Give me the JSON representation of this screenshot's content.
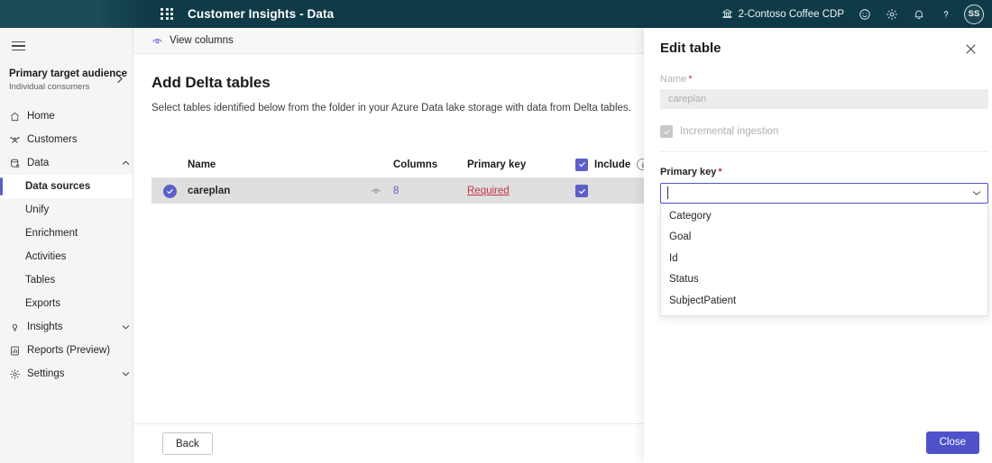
{
  "header": {
    "app_title": "Customer Insights - Data",
    "waffle_icon": "app-launcher-icon",
    "environment": "2-Contoso Coffee CDP",
    "environment_icon": "environment-icon",
    "feedback_icon": "smiley-feedback-icon",
    "settings_icon": "gear-icon",
    "notifications_icon": "bell-icon",
    "help_icon": "question-mark-icon",
    "avatar_initials": "SS"
  },
  "sidebar": {
    "menu_icon": "hamburger-menu-icon",
    "audience": {
      "title": "Primary target audience",
      "subtitle": "Individual consumers",
      "chevron": "chevron-right-icon"
    },
    "items": [
      {
        "label": "Home",
        "icon": "home-icon",
        "level": "top",
        "active": false,
        "expandable": false
      },
      {
        "label": "Customers",
        "icon": "customers-icon",
        "level": "top",
        "active": false,
        "expandable": false
      },
      {
        "label": "Data",
        "icon": "database-icon",
        "level": "top",
        "active": false,
        "expandable": true,
        "expanded": true
      },
      {
        "label": "Data sources",
        "icon": "",
        "level": "sub",
        "active": true,
        "expandable": false
      },
      {
        "label": "Unify",
        "icon": "",
        "level": "sub",
        "active": false,
        "expandable": false
      },
      {
        "label": "Enrichment",
        "icon": "",
        "level": "sub",
        "active": false,
        "expandable": false
      },
      {
        "label": "Activities",
        "icon": "",
        "level": "sub",
        "active": false,
        "expandable": false
      },
      {
        "label": "Tables",
        "icon": "",
        "level": "sub",
        "active": false,
        "expandable": false
      },
      {
        "label": "Exports",
        "icon": "",
        "level": "sub",
        "active": false,
        "expandable": false
      },
      {
        "label": "Insights",
        "icon": "lightbulb-icon",
        "level": "top",
        "active": false,
        "expandable": true,
        "expanded": false
      },
      {
        "label": "Reports (Preview)",
        "icon": "report-icon",
        "level": "top",
        "active": false,
        "expandable": false
      },
      {
        "label": "Settings",
        "icon": "gear-icon",
        "level": "top",
        "active": false,
        "expandable": true,
        "expanded": false
      }
    ]
  },
  "commandbar": {
    "view_columns_label": "View columns",
    "view_columns_icon": "eye-icon"
  },
  "main": {
    "title": "Add Delta tables",
    "subtitle": "Select tables identified below from the folder in your Azure Data lake storage with data from Delta tables.",
    "table": {
      "columns": [
        "Name",
        "Columns",
        "Primary key",
        "Include"
      ],
      "header_include_checked": true,
      "header_info_icon": "info-icon",
      "rows": [
        {
          "selected": true,
          "name": "careplan",
          "preview_icon": "eye-icon",
          "columns": "8",
          "primary_key": "Required",
          "include_checked": true
        }
      ]
    },
    "back_label": "Back"
  },
  "panel": {
    "title": "Edit table",
    "close_icon": "close-icon",
    "name_label": "Name",
    "name_value": "careplan",
    "name_required": true,
    "name_disabled": true,
    "incremental_label": "Incremental ingestion",
    "incremental_checked": true,
    "incremental_disabled": true,
    "primary_key_label": "Primary key",
    "primary_key_required": true,
    "primary_key_value": "",
    "primary_key_placeholder": "",
    "dropdown_icon": "chevron-down-icon",
    "dropdown_open": true,
    "dropdown_options": [
      "Category",
      "Goal",
      "Id",
      "Status",
      "SubjectPatient"
    ],
    "close_button_label": "Close"
  },
  "colors": {
    "accent": "#5b5fc7",
    "primary_button": "#4f52c9",
    "required_red": "#c4314b",
    "header_bg": "#14414f"
  }
}
